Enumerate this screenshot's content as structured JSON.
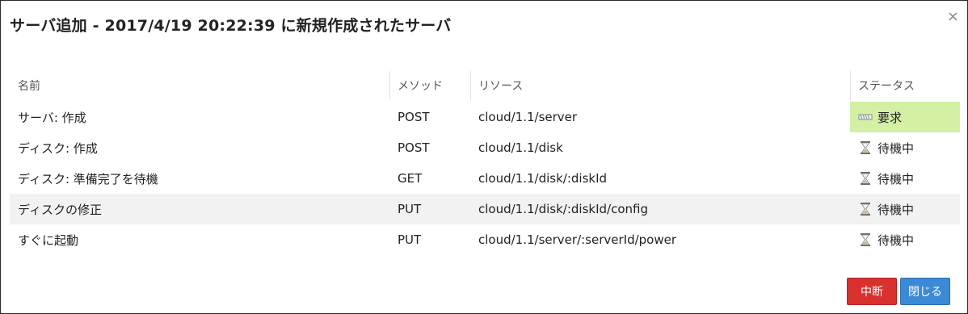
{
  "dialog": {
    "title": "サーバ追加 - 2017/4/19 20:22:39 に新規作成されたサーバ",
    "close_label": "×"
  },
  "table": {
    "headers": {
      "name": "名前",
      "method": "メソッド",
      "resource": "リソース",
      "status": "ステータス"
    },
    "rows": [
      {
        "name": "サーバ: 作成",
        "method": "POST",
        "resource": "cloud/1.1/server",
        "status": "要求",
        "status_icon": "requesting-icon"
      },
      {
        "name": "ディスク: 作成",
        "method": "POST",
        "resource": "cloud/1.1/disk",
        "status": "待機中",
        "status_icon": "hourglass-icon"
      },
      {
        "name": "ディスク: 準備完了を待機",
        "method": "GET",
        "resource": "cloud/1.1/disk/:diskId",
        "status": "待機中",
        "status_icon": "hourglass-icon"
      },
      {
        "name": "ディスクの修正",
        "method": "PUT",
        "resource": "cloud/1.1/disk/:diskId/config",
        "status": "待機中",
        "status_icon": "hourglass-icon"
      },
      {
        "name": "すぐに起動",
        "method": "PUT",
        "resource": "cloud/1.1/server/:serverId/power",
        "status": "待機中",
        "status_icon": "hourglass-icon"
      }
    ]
  },
  "buttons": {
    "abort": "中断",
    "close": "閉じる"
  },
  "colors": {
    "status_requesting_bg": "#d3f0a4",
    "abort_button": "#d9312e",
    "close_button": "#3a8ad6"
  }
}
